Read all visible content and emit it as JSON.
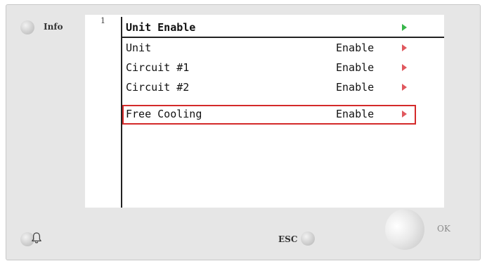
{
  "info_label": "Info",
  "esc_label": "ESC",
  "ok_label": "OK",
  "screen": {
    "row_number": "1",
    "title": "Unit Enable",
    "items": [
      {
        "label": "Unit",
        "value": "Enable"
      },
      {
        "label": "Circuit #1",
        "value": "Enable"
      },
      {
        "label": "Circuit #2",
        "value": "Enable"
      },
      {
        "label": "Free Cooling",
        "value": "Enable",
        "selected": true
      }
    ]
  },
  "colors": {
    "selection_border": "#d42a2a",
    "header_arrow": "#37b64a",
    "item_arrow": "#e0585e"
  },
  "icons": {
    "alarm": "bell-icon",
    "item_arrow": "triangle-right-icon"
  }
}
